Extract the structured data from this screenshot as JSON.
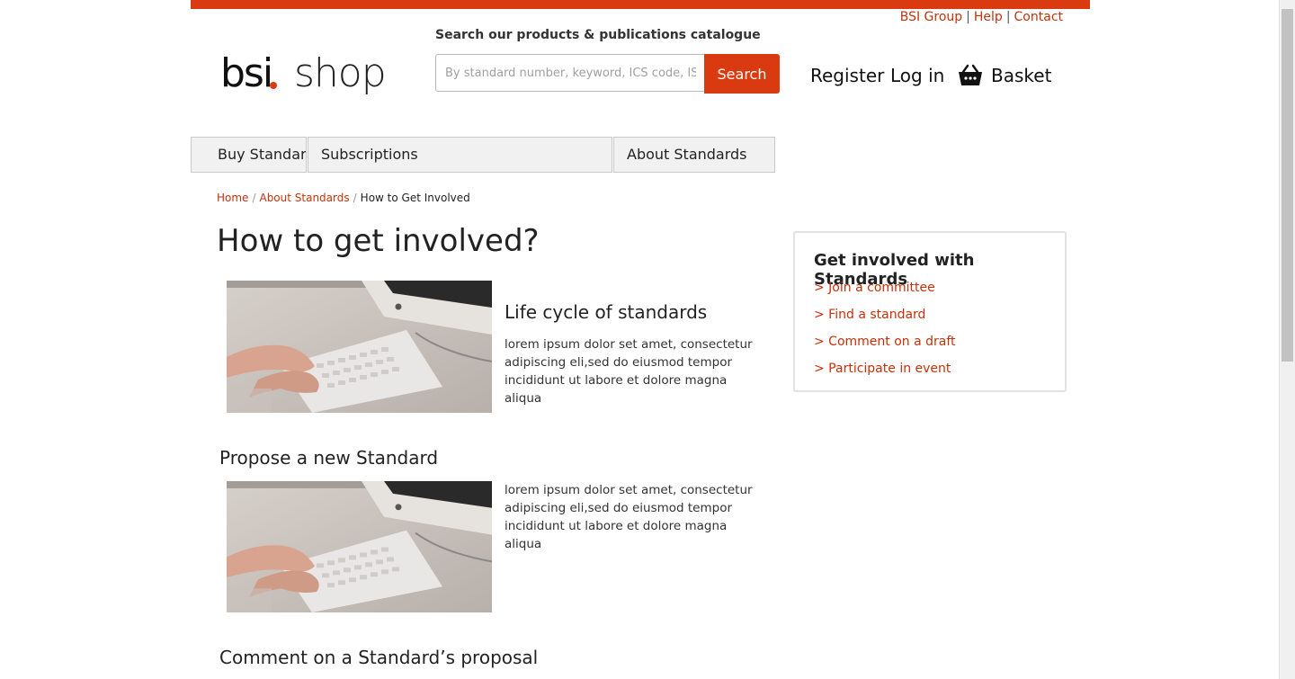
{
  "utility_links": {
    "bsi_group": "BSI Group",
    "help": "Help",
    "contact": "Contact",
    "separator": "|"
  },
  "logo": {
    "bsi": "bsi",
    "shop": "shop"
  },
  "search": {
    "label": "Search our products & publications catalogue",
    "placeholder": "By standard number, keyword, ICS code, ISBN",
    "button": "Search"
  },
  "account": {
    "register": "Register",
    "login": "Log in",
    "basket": "Basket",
    "basket_icon": "basket-icon"
  },
  "nav": {
    "items": [
      {
        "label": "Buy Standards"
      },
      {
        "label": "Subscriptions"
      },
      {
        "label": "About Standards"
      }
    ]
  },
  "breadcrumb": {
    "home": "Home",
    "about": "About Standards",
    "current": "How to Get Involved",
    "separator": "/"
  },
  "main": {
    "title": "How to get involved?",
    "cards": [
      {
        "title": "Life cycle of standards",
        "text": "lorem ipsum dolor set amet, consectetur adipiscing eli,sed do eiusmod tempor incididunt ut labore et dolore magna aliqua"
      },
      {
        "section_title": "Propose a new Standard",
        "text": "lorem ipsum dolor set amet, consectetur adipiscing eli,sed do eiusmod tempor incididunt ut labore et dolore magna aliqua"
      },
      {
        "section_title": "Comment on a Standard’s proposal"
      }
    ]
  },
  "sidebar": {
    "title": "Get involved with Standards",
    "links": [
      "> Join a committee",
      "> Find a standard",
      "> Comment on a draft",
      "> Participate in event"
    ]
  },
  "colors": {
    "brand": "#d93a0f",
    "link": "#c4320a"
  }
}
